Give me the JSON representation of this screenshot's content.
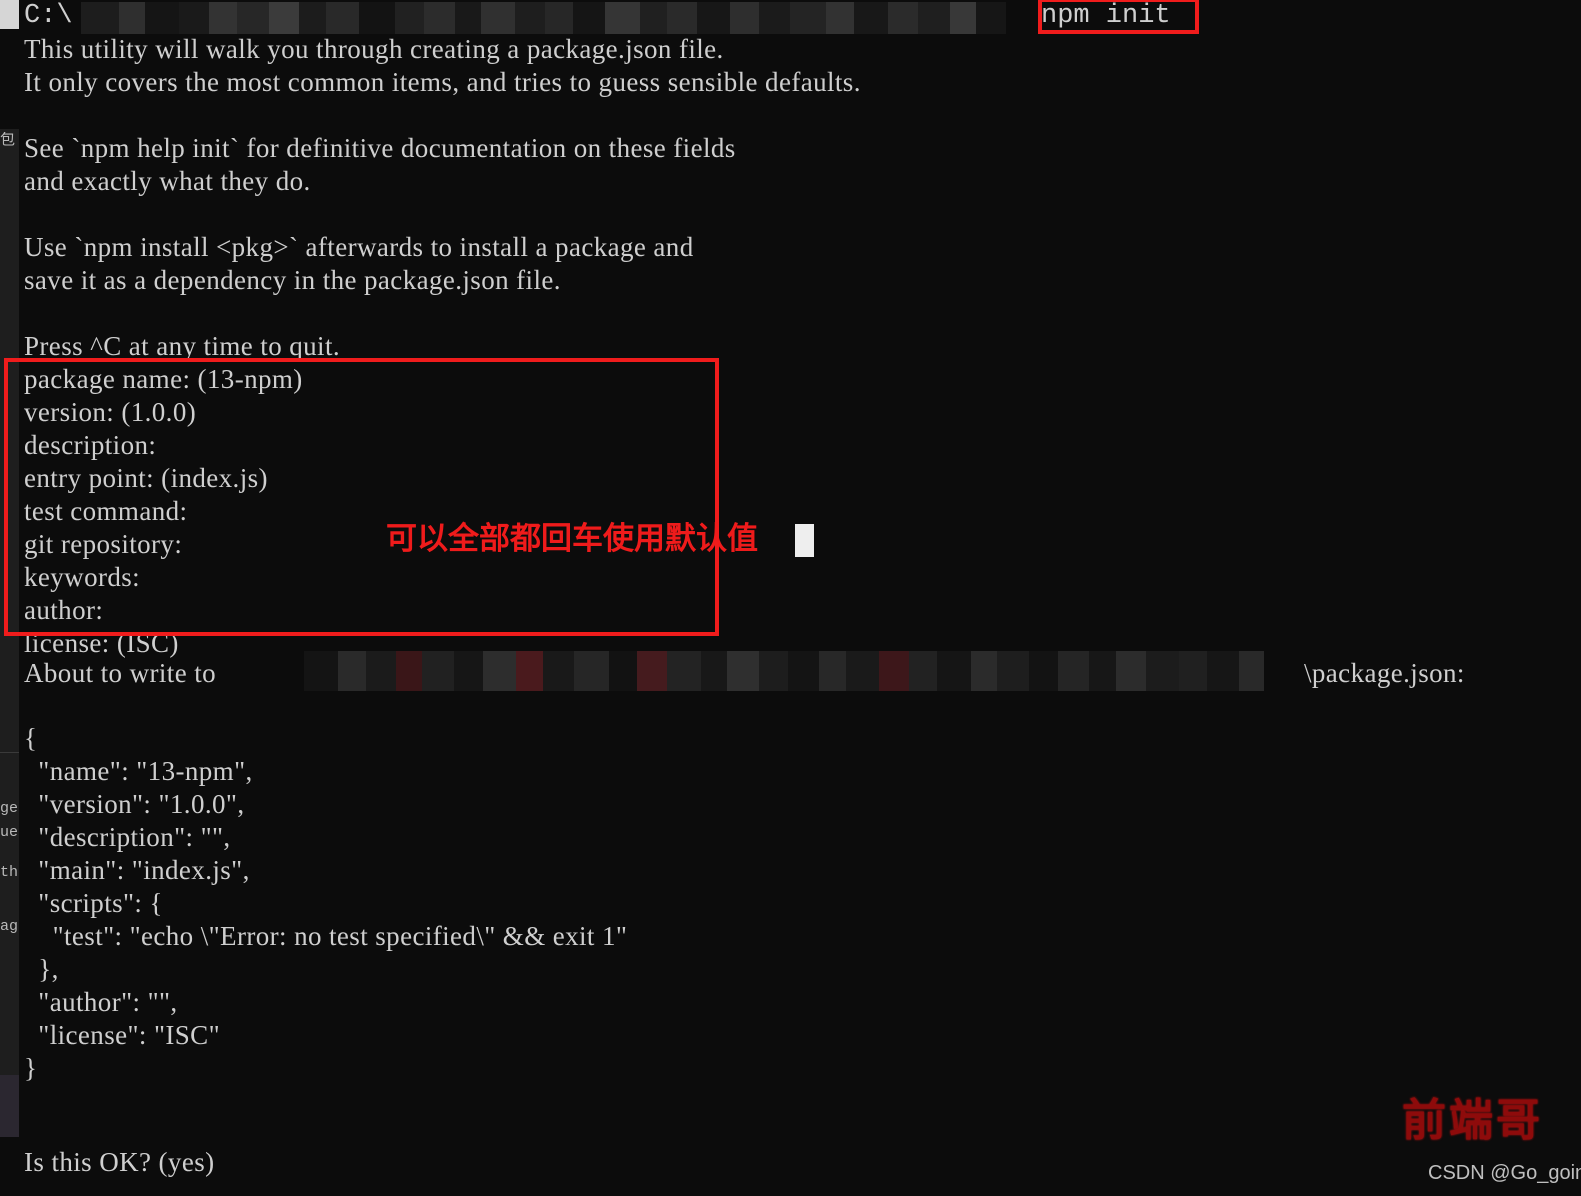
{
  "window": {
    "type": "windows-command-prompt",
    "background_color": "#0c0c0c",
    "text_color": "#cfcfcf"
  },
  "prompt_line": {
    "drive": "C:\\",
    "redacted_path_note": "blurred",
    "command": "npm init"
  },
  "intro_lines": [
    "This utility will walk you through creating a package.json file.",
    "It only covers the most common items, and tries to guess sensible defaults.",
    "",
    "See `npm help init` for definitive documentation on these fields",
    "and exactly what they do.",
    "",
    "Use `npm install <pkg>` afterwards to install a package and",
    "save it as a dependency in the package.json file.",
    "",
    "Press ^C at any time to quit."
  ],
  "prompts": [
    "package name: (13-npm)",
    "version: (1.0.0)",
    "description:",
    "entry point: (index.js)",
    "test command:",
    "git repository:",
    "keywords:",
    "author:",
    "license: (ISC)"
  ],
  "about_to_write": {
    "prefix": "About to write to ",
    "suffix": "\\package.json:"
  },
  "package_json_lines": [
    "{",
    "  \"name\": \"13-npm\",",
    "  \"version\": \"1.0.0\",",
    "  \"description\": \"\",",
    "  \"main\": \"index.js\",",
    "  \"scripts\": {",
    "    \"test\": \"echo \\\"Error: no test specified\\\" && exit 1\"",
    "  },",
    "  \"author\": \"\",",
    "  \"license\": \"ISC\"",
    "}"
  ],
  "confirm_line": "Is this OK? (yes)",
  "annotations": {
    "color": "#f01c1c",
    "command_box_label": "npm init",
    "prompts_box_note": "可以全部都回车使用默认值"
  },
  "background_window_fragments": [
    "包",
    "ge.",
    "ue",
    "th",
    "ag"
  ],
  "watermark": {
    "main": "前端哥",
    "sub": "CSDN @Go_going_"
  }
}
